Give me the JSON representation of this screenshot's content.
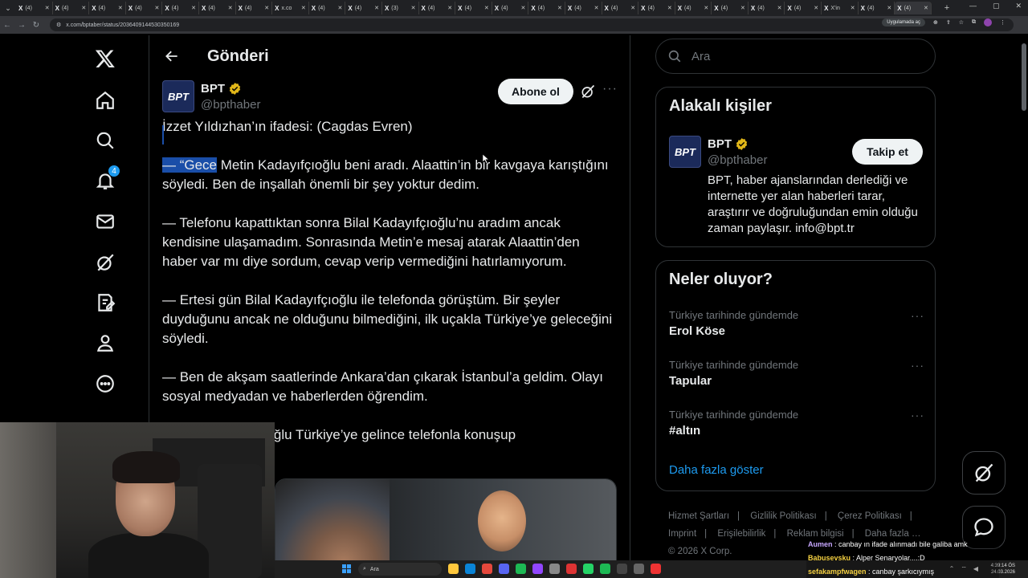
{
  "browser": {
    "tab_count": 25,
    "tab_label": "(4)",
    "tab_alt_labels": [
      "x.co",
      "(3)",
      "X'in"
    ],
    "address": "x.com/bptaber/status/2036409144530350169",
    "app_button": "Uygulamada aç"
  },
  "nav": {
    "items": [
      {
        "name": "x-logo-icon"
      },
      {
        "name": "home-icon"
      },
      {
        "name": "explore-icon"
      },
      {
        "name": "notifications-icon",
        "badge": "4"
      },
      {
        "name": "messages-icon"
      },
      {
        "name": "grok-icon"
      },
      {
        "name": "lists-icon"
      },
      {
        "name": "profile-icon"
      },
      {
        "name": "more-icon"
      }
    ]
  },
  "post": {
    "header_title": "Gönderi",
    "author_name": "BPT",
    "author_handle": "@bpthaber",
    "avatar_text": "BPT",
    "subscribe_label": "Abone ol",
    "p1": "İzzet Yıldızhan’ın ifadesi: (Cagdas Evren)",
    "p2_selected": "— “Gece",
    "p2_rest": " Metin Kadayıfçıoğlu beni aradı. Alaattin’in bir kavgaya karıştığını söyledi. Ben de inşallah önemli bir şey yoktur dedim.",
    "p3": "— Telefonu kapattıktan sonra Bilal Kadayıfçıoğlu’nu aradım ancak kendisine ulaşamadım. Sonrasında Metin’e mesaj atarak Alaattin’den haber var mı diye sordum, cevap verip vermediğini hatırlamıyorum.",
    "p4": "— Ertesi gün Bilal Kadayıfçıoğlu ile telefonda görüştüm. Bir şeyler duyduğunu ancak ne olduğunu bilmediğini, ilk uçakla Türkiye’ye geleceğini söyledi.",
    "p5": "— Ben de akşam saatlerinde Ankara’dan çıkarak İstanbul’a geldim. Olayı sosyal medyadan ve haberlerden öğrendim.",
    "p6": "— Bilal Kadayıfçıoğlu Türkiye’ye gelince telefonla konuşup"
  },
  "sidebar": {
    "search_placeholder": "Ara",
    "related_title": "Alakalı kişiler",
    "related": {
      "name": "BPT",
      "handle": "@bpthaber",
      "avatar_text": "BPT",
      "follow_label": "Takip et",
      "bio": "BPT, haber ajanslarından derlediği ve internette yer alan haberleri tarar, araştırır ve doğruluğundan emin olduğu zaman paylaşır. info@bpt.tr"
    },
    "trends_title": "Neler oluyor?",
    "trends": [
      {
        "context": "Türkiye tarihinde gündemde",
        "title": "Erol Köse"
      },
      {
        "context": "Türkiye tarihinde gündemde",
        "title": "Tapular"
      },
      {
        "context": "Türkiye tarihinde gündemde",
        "title": "#altın"
      }
    ],
    "show_more": "Daha fazla göster",
    "footer_links": [
      "Hizmet Şartları",
      "Gizlilik Politikası",
      "Çerez Politikası",
      "Imprint",
      "Erişilebilirlik",
      "Reklam bilgisi",
      "Daha fazla …"
    ],
    "copyright": "© 2026 X Corp."
  },
  "chat": [
    {
      "user": "Aumen",
      "text": " : canbay ın ifade alınmadı bile galiba amk"
    },
    {
      "user": "Babusevsku",
      "text": " : Alper Senaryolar....:D"
    },
    {
      "user": "sefakampfwagen",
      "text": " : canbay şarkıcıymış"
    }
  ],
  "taskbar": {
    "search_placeholder": "Ara",
    "time": "4:39:14 ÖS",
    "date": "24.03.2026"
  },
  "colors": {
    "accent": "#1d9bf0",
    "background": "#000000",
    "border": "#2f3336",
    "muted": "#71767b",
    "selection": "#1a4ea8"
  }
}
